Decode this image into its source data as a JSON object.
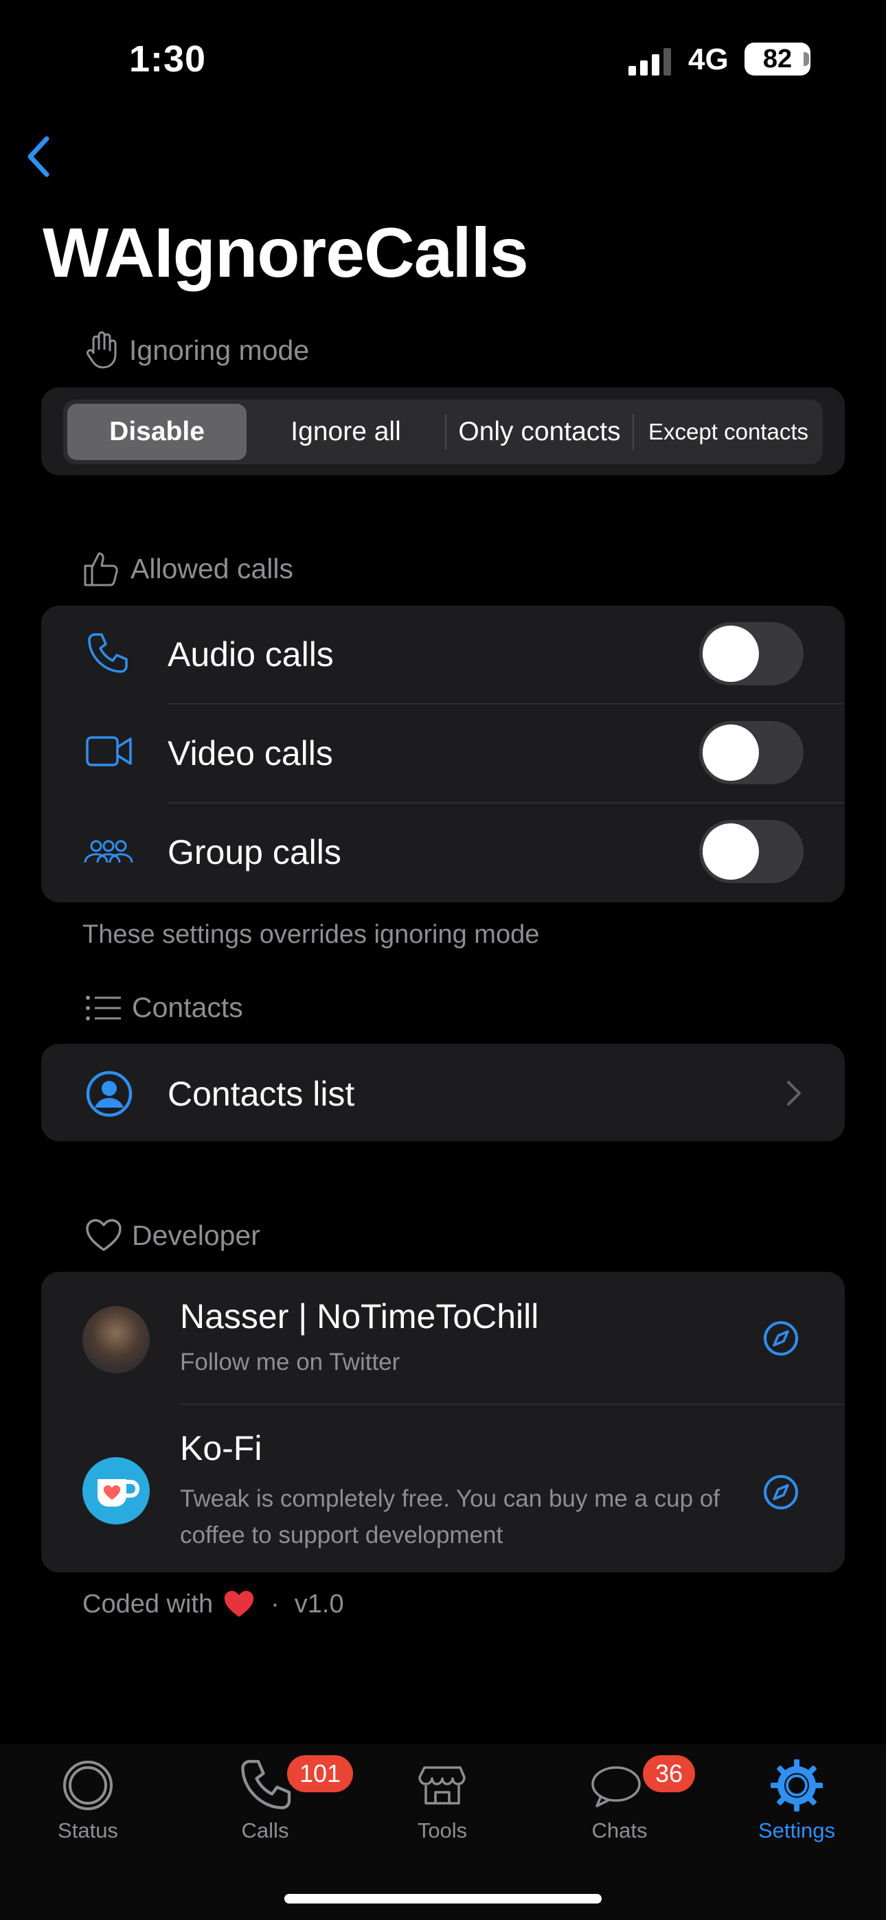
{
  "status_bar": {
    "time": "1:30",
    "network": "4G",
    "battery": "82"
  },
  "header": {
    "title": "WAIgnoreCalls"
  },
  "ignoring_mode": {
    "section_label": "Ignoring mode",
    "options": [
      "Disable",
      "Ignore all",
      "Only contacts",
      "Except contacts"
    ],
    "selected": "Disable"
  },
  "allowed_calls": {
    "section_label": "Allowed calls",
    "items": [
      {
        "label": "Audio calls",
        "icon": "phone-icon",
        "enabled": false
      },
      {
        "label": "Video calls",
        "icon": "video-camera-icon",
        "enabled": false
      },
      {
        "label": "Group calls",
        "icon": "group-icon",
        "enabled": false
      }
    ],
    "footnote": "These settings overrides ignoring mode"
  },
  "contacts": {
    "section_label": "Contacts",
    "item_label": "Contacts list"
  },
  "developer": {
    "section_label": "Developer",
    "items": [
      {
        "title": "Nasser | NoTimeToChill",
        "subtitle": "Follow me on Twitter",
        "icon": "compass-icon"
      },
      {
        "title": "Ko-Fi",
        "subtitle": "Tweak is completely free. You can buy me a cup of coffee to support development",
        "icon": "compass-icon"
      }
    ]
  },
  "footer": {
    "coded_with": "Coded with",
    "separator": "·",
    "version": "v1.0"
  },
  "tab_bar": {
    "tabs": [
      {
        "label": "Status"
      },
      {
        "label": "Calls",
        "badge": "101"
      },
      {
        "label": "Tools"
      },
      {
        "label": "Chats",
        "badge": "36"
      },
      {
        "label": "Settings"
      }
    ],
    "active": "Settings"
  },
  "colors": {
    "accent": "#2f8ff3",
    "badge": "#e94434",
    "card": "#1c1c1e"
  }
}
